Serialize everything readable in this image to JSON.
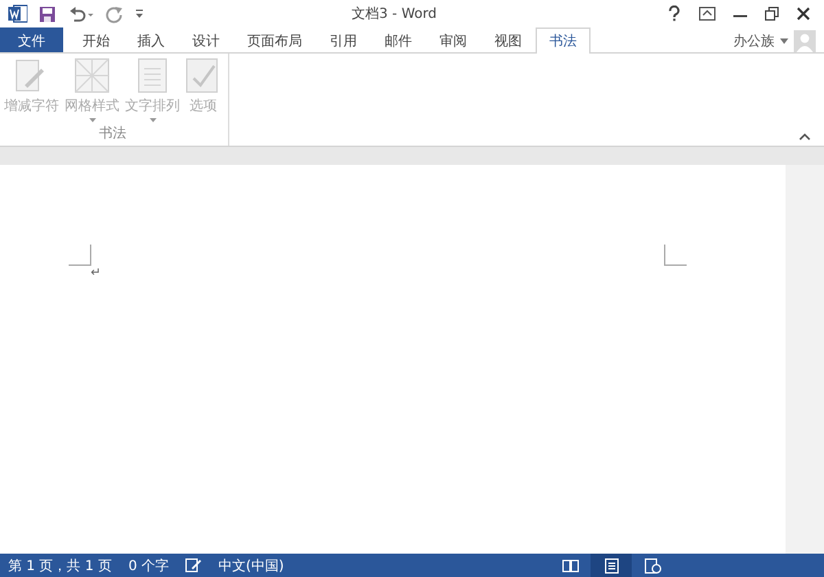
{
  "window": {
    "title": "文档3 - Word"
  },
  "tabs": [
    {
      "label": "文件",
      "kind": "file",
      "selected": false
    },
    {
      "label": "开始",
      "kind": "tab",
      "selected": false
    },
    {
      "label": "插入",
      "kind": "tab",
      "selected": false
    },
    {
      "label": "设计",
      "kind": "tab",
      "selected": false
    },
    {
      "label": "页面布局",
      "kind": "tab",
      "selected": false
    },
    {
      "label": "引用",
      "kind": "tab",
      "selected": false
    },
    {
      "label": "邮件",
      "kind": "tab",
      "selected": false
    },
    {
      "label": "审阅",
      "kind": "tab",
      "selected": false
    },
    {
      "label": "视图",
      "kind": "tab",
      "selected": false
    },
    {
      "label": "书法",
      "kind": "tab",
      "selected": true
    }
  ],
  "account": {
    "name": "办公族"
  },
  "ribbon": {
    "groups": [
      {
        "label": "书法",
        "buttons": [
          {
            "label": "增减字符",
            "kind": "pen",
            "dropdown": false,
            "disabled": true
          },
          {
            "label": "网格样式",
            "kind": "grid",
            "dropdown": true,
            "disabled": true
          },
          {
            "label": "文字排列",
            "kind": "doc",
            "dropdown": true,
            "disabled": true
          },
          {
            "label": "选项",
            "kind": "check",
            "dropdown": false,
            "disabled": true
          }
        ]
      }
    ]
  },
  "document": {
    "paragraph_mark": "↵"
  },
  "status_bar": {
    "items": [
      "第 1 页，共 1 页",
      "0 个字",
      "中文(中国)"
    ],
    "views": [
      {
        "kind": "read",
        "selected": false
      },
      {
        "kind": "print",
        "selected": true
      },
      {
        "kind": "web",
        "selected": false
      }
    ]
  }
}
